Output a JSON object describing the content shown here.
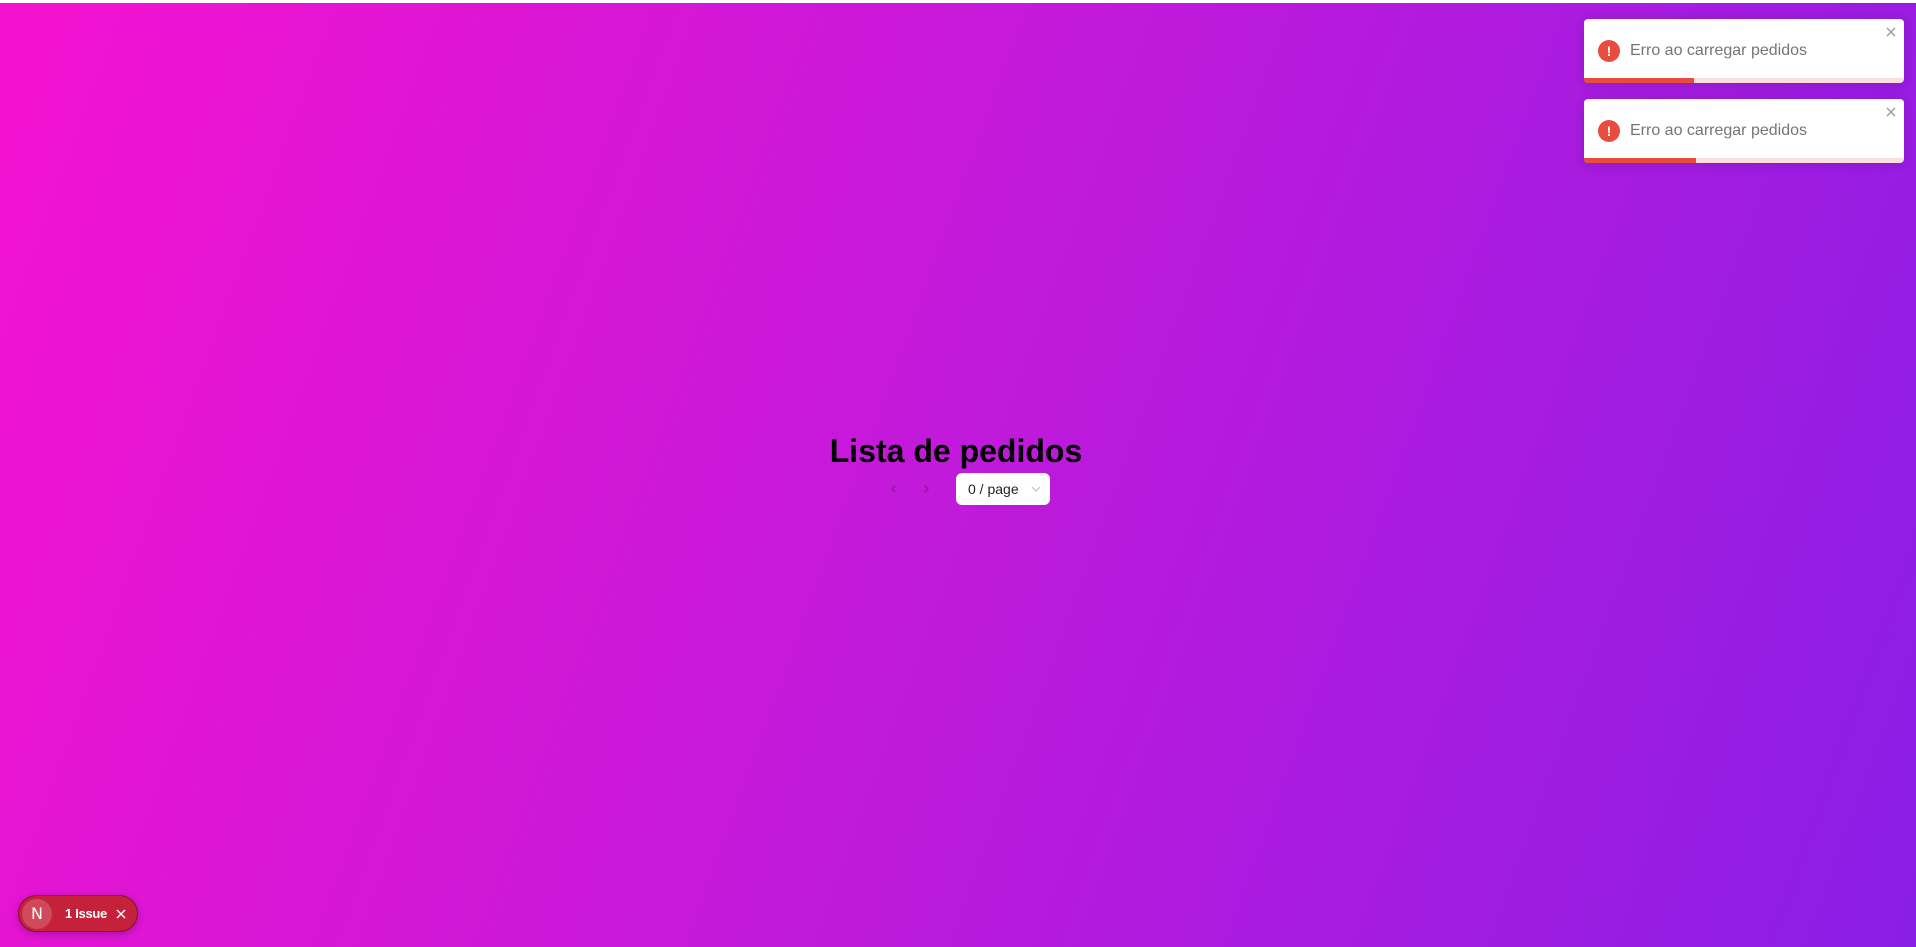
{
  "page": {
    "title": "Lista de pedidos",
    "background_colors": [
      "#f512d0",
      "#c619d9",
      "#8a1ee6"
    ]
  },
  "pagination": {
    "prev_icon": "chevron-left-icon",
    "next_icon": "chevron-right-icon",
    "page_size_label": "0 / page",
    "page_size_icon": "chevron-down-icon"
  },
  "toasts": [
    {
      "message": "Erro ao carregar pedidos",
      "icon": "error-icon",
      "icon_glyph": "!",
      "close_icon": "close-icon",
      "progress": 0.345,
      "color": "#e74c3c"
    },
    {
      "message": "Erro ao carregar pedidos",
      "icon": "error-icon",
      "icon_glyph": "!",
      "close_icon": "close-icon",
      "progress": 0.35,
      "color": "#e74c3c"
    }
  ],
  "dev_indicator": {
    "logo_glyph": "N",
    "label": "1 Issue",
    "close_icon": "close-icon",
    "color": "#c6213a"
  }
}
